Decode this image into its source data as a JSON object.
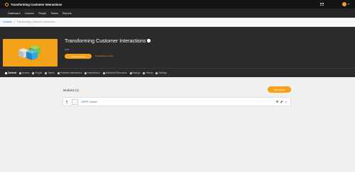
{
  "app": {
    "title": "Transforming Customer Interactions"
  },
  "nav": {
    "items": [
      "Dashboard",
      "Courses",
      "People",
      "Teams",
      "Reports"
    ]
  },
  "breadcrumb": {
    "root": "Courses",
    "separator": "/",
    "current": "Transforming Customer Interactions"
  },
  "course": {
    "title": "Transforming Customer Interactions",
    "status": "LIVE",
    "preview_label": "Preview course",
    "translations_label": "Translations (none)"
  },
  "tabs": [
    "Content",
    "Access",
    "People",
    "Teams",
    "Proficient Interactions",
    "Noticeboard",
    "Additional Resources",
    "Ratings",
    "History",
    "Settings"
  ],
  "modules": {
    "heading": "Modules (1)",
    "add_label": "Add content",
    "rows": [
      {
        "index": "1",
        "name": "GDPR Course"
      }
    ]
  },
  "colors": {
    "accent": "#f4a21a",
    "topbar": "#141414",
    "hero": "#2b2b2b",
    "link": "#2f6fb5"
  },
  "icons": [
    "brand-icon",
    "apps-grid-icon",
    "avatar",
    "info-icon",
    "drag-handle-icon",
    "eye-icon",
    "pencil-icon",
    "close-icon"
  ]
}
